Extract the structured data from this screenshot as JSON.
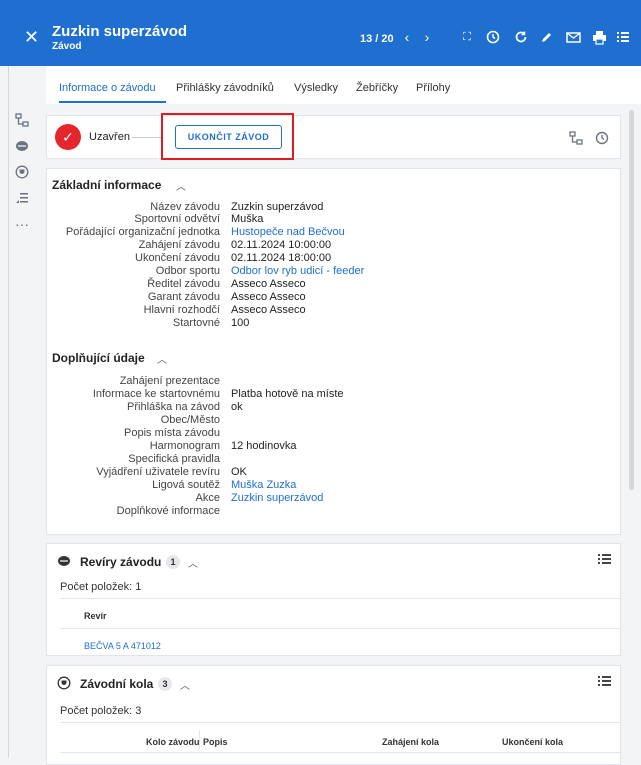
{
  "header": {
    "title": "Zuzkin superzávod",
    "subtitle": "Závod",
    "counter": "13 / 20",
    "icons": [
      "close-icon",
      "chevron-left-icon",
      "chevron-right-icon",
      "fullscreen-icon",
      "history-icon",
      "refresh-icon",
      "edit-icon",
      "mail-icon",
      "print-icon",
      "list-icon"
    ]
  },
  "tabs": [
    {
      "label": "Informace o závodu",
      "active": true
    },
    {
      "label": "Přihlášky závodníků"
    },
    {
      "label": "Výsledky"
    },
    {
      "label": "Žebříčky"
    },
    {
      "label": "Přílohy"
    }
  ],
  "status": {
    "label": "Uzavřen",
    "end_button": "UKONČIT ZÁVOD"
  },
  "basic": {
    "title": "Základní informace",
    "rows": [
      {
        "label": "Název závodu",
        "value": "Zuzkin superzávod"
      },
      {
        "label": "Sportovní odvětví",
        "value": "Muška"
      },
      {
        "label": "Pořádající organizační jednotka",
        "value": "Hustopeče nad Bečvou",
        "link": true
      },
      {
        "label": "Zahájení závodu",
        "value": "02.11.2024 10:00:00"
      },
      {
        "label": "Ukončení závodu",
        "value": "02.11.2024 18:00:00"
      },
      {
        "label": "Odbor sportu",
        "value": "Odbor lov ryb udicí - feeder",
        "link": true
      },
      {
        "label": "Ředitel závodu",
        "value": "Asseco Asseco"
      },
      {
        "label": "Garant závodu",
        "value": "Asseco Asseco"
      },
      {
        "label": "Hlavní rozhodčí",
        "value": "Asseco Asseco"
      },
      {
        "label": "Startovné",
        "value": "100"
      }
    ]
  },
  "extra": {
    "title": "Doplňující údaje",
    "rows": [
      {
        "label": "Zahájení prezentace",
        "value": ""
      },
      {
        "label": "Informace ke startovnému",
        "value": "Platba hotově na míste"
      },
      {
        "label": "Přihláška na závod",
        "value": "ok"
      },
      {
        "label": "Obec/Město",
        "value": ""
      },
      {
        "label": "Popis místa závodu",
        "value": ""
      },
      {
        "label": "Harmonogram",
        "value": "12 hodinovka"
      },
      {
        "label": "Specifická pravidla",
        "value": ""
      },
      {
        "label": "Vyjádření uživatele revíru",
        "value": "OK"
      },
      {
        "label": "Ligová soutěž",
        "value": "Muška Zuzka",
        "link": true
      },
      {
        "label": "Akce",
        "value": "Zuzkin superzávod",
        "link": true
      },
      {
        "label": "Doplňkové informace",
        "value": ""
      }
    ]
  },
  "reviry": {
    "title": "Revíry závodu",
    "badge": "1",
    "count_text": "Počet položek: 1",
    "column": "Revír",
    "rows": [
      "BEČVA 5 A 471012"
    ]
  },
  "kola": {
    "title": "Závodní kola",
    "badge": "3",
    "count_text": "Počet položek: 3",
    "columns": [
      "Kolo závodu",
      "Popis",
      "Zahájení kola",
      "Ukončení kola"
    ]
  }
}
